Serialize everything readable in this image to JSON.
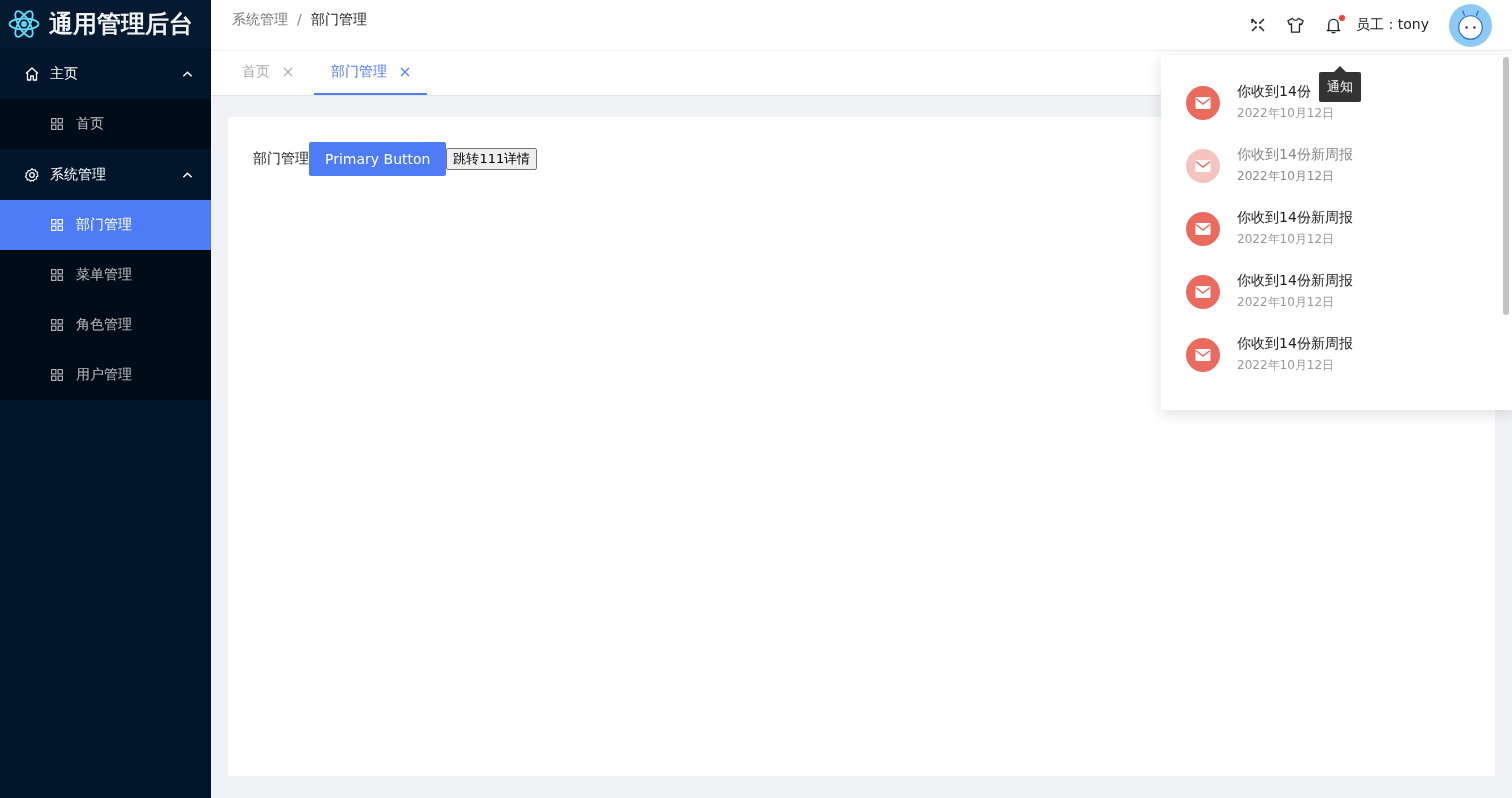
{
  "logo": {
    "title": "通用管理后台"
  },
  "sidebar": {
    "groups": [
      {
        "label": "主页",
        "expanded": true,
        "items": [
          {
            "label": "首页",
            "selected": false
          }
        ]
      },
      {
        "label": "系统管理",
        "expanded": true,
        "items": [
          {
            "label": "部门管理",
            "selected": true
          },
          {
            "label": "菜单管理",
            "selected": false
          },
          {
            "label": "角色管理",
            "selected": false
          },
          {
            "label": "用户管理",
            "selected": false
          }
        ]
      }
    ]
  },
  "breadcrumb": {
    "separator": "/",
    "items": [
      "系统管理",
      "部门管理"
    ]
  },
  "header": {
    "user": "员工：tony",
    "has_unread": true,
    "tooltip": "通知"
  },
  "tabs": [
    {
      "label": "首页",
      "selected": false
    },
    {
      "label": "部门管理",
      "selected": true
    }
  ],
  "content": {
    "label": "部门管理",
    "primary_button": "Primary Button",
    "plain_button": "跳转111详情"
  },
  "notifications": [
    {
      "title": "你收到14份",
      "date": "2022年10月12日",
      "faded": false
    },
    {
      "title": "你收到14份新周报",
      "date": "2022年10月12日",
      "faded": true
    },
    {
      "title": "你收到14份新周报",
      "date": "2022年10月12日",
      "faded": false
    },
    {
      "title": "你收到14份新周报",
      "date": "2022年10月12日",
      "faded": false
    },
    {
      "title": "你收到14份新周报",
      "date": "2022年10月12日",
      "faded": false
    }
  ]
}
